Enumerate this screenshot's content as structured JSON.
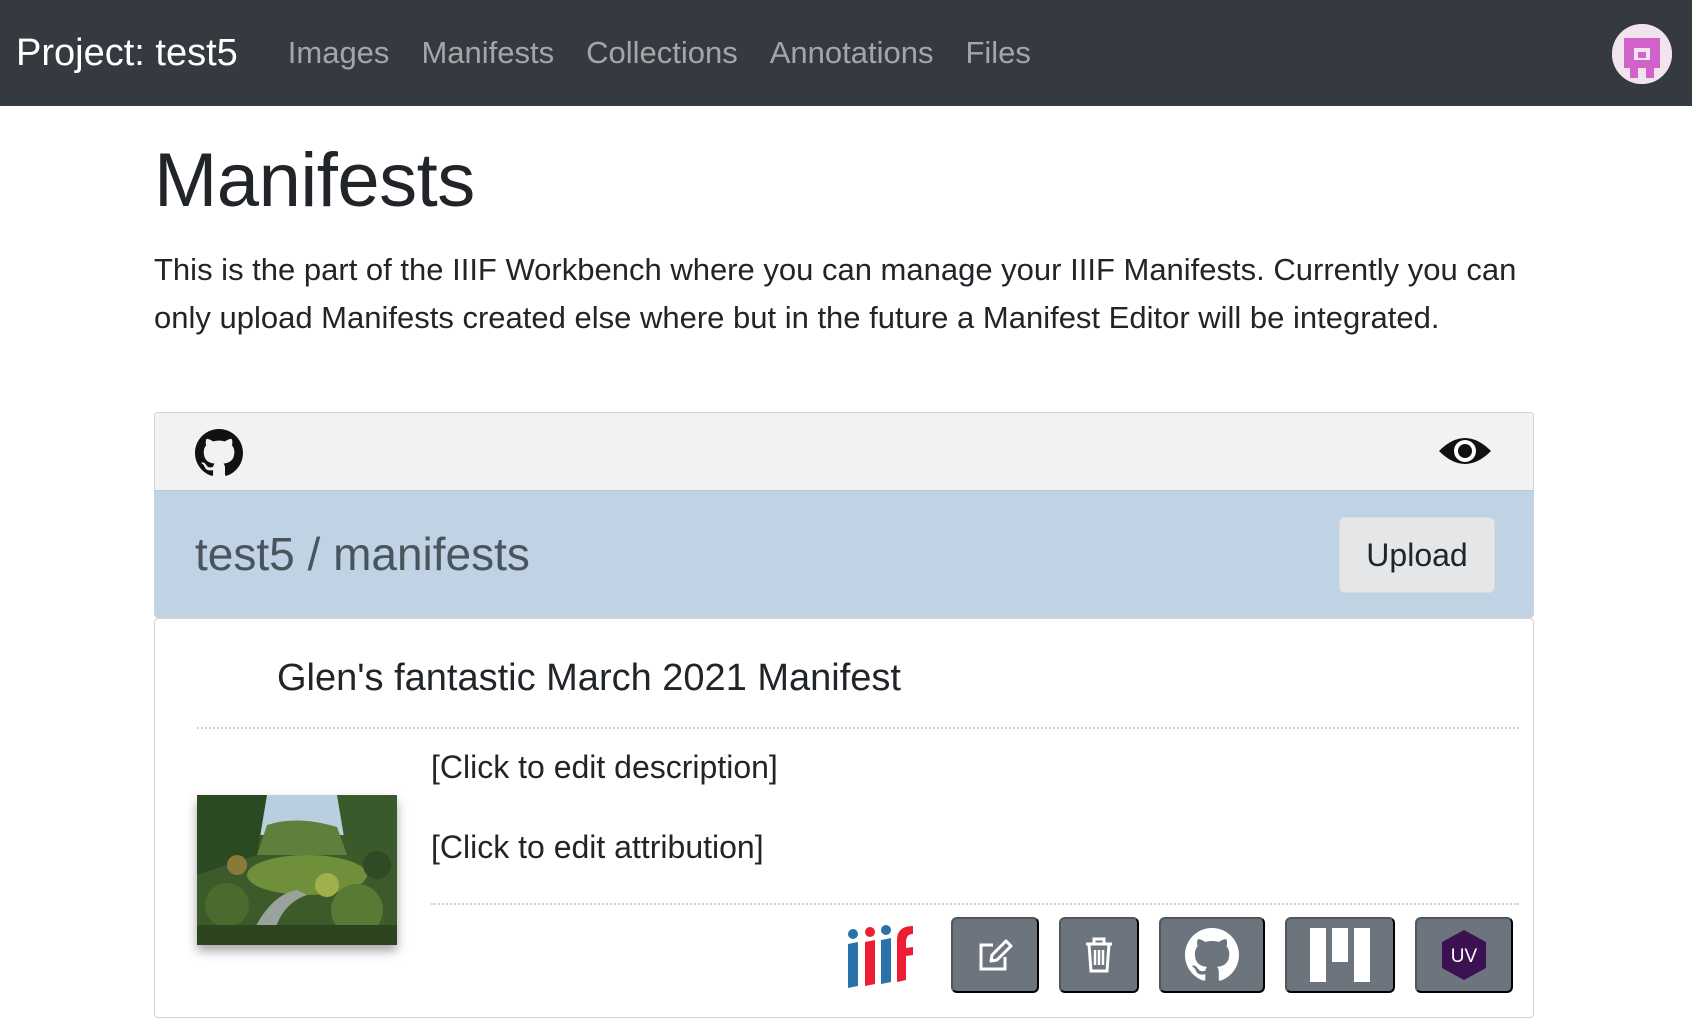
{
  "navbar": {
    "brand": "Project: test5",
    "links": [
      "Images",
      "Manifests",
      "Collections",
      "Annotations",
      "Files"
    ],
    "avatar_icon": "identicon-avatar"
  },
  "page": {
    "title": "Manifests",
    "intro": "This is the part of the IIIF Workbench where you can manage your IIIF Manifests. Currently you can only upload Manifests created else where but in the future a Manifest Editor will be integrated."
  },
  "repo": {
    "toolbar_icons": [
      "github-icon",
      "eye-icon"
    ],
    "path": "test5 / manifests",
    "upload_label": "Upload",
    "header_color": "#c0d3e4"
  },
  "manifest": {
    "title": "Glen's fantastic March 2021 Manifest",
    "description": "[Click to edit description]",
    "attribution": "[Click to edit attribution]",
    "thumbnail_icon": "garden-thumbnail",
    "actions": {
      "iiif_icon": "iiif-logo",
      "edit_icon": "edit-icon",
      "delete_icon": "trash-icon",
      "github_icon": "github-icon",
      "mirador_icon": "mirador-icon",
      "uv_label": "UV"
    }
  }
}
